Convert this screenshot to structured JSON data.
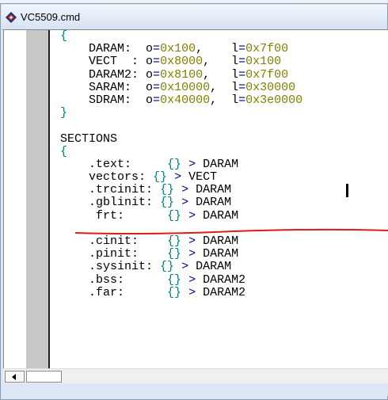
{
  "window": {
    "title": "VC5509.cmd",
    "icon": "diamond-app-icon"
  },
  "editor": {
    "lines": [
      [
        {
          "t": "{",
          "c": "brace"
        }
      ],
      [
        {
          "t": "    DARAM:  ",
          "c": "kw"
        },
        {
          "t": "o",
          "c": "kw"
        },
        {
          "t": "=",
          "c": "op"
        },
        {
          "t": "0x100",
          "c": "num"
        },
        {
          "t": ",    ",
          "c": "kw"
        },
        {
          "t": "l",
          "c": "kw"
        },
        {
          "t": "=",
          "c": "op"
        },
        {
          "t": "0x7f00",
          "c": "num"
        }
      ],
      [
        {
          "t": "    VECT  : ",
          "c": "kw"
        },
        {
          "t": "o",
          "c": "kw"
        },
        {
          "t": "=",
          "c": "op"
        },
        {
          "t": "0x8000",
          "c": "num"
        },
        {
          "t": ",   ",
          "c": "kw"
        },
        {
          "t": "l",
          "c": "kw"
        },
        {
          "t": "=",
          "c": "op"
        },
        {
          "t": "0x100",
          "c": "num"
        }
      ],
      [
        {
          "t": "    DARAM2: ",
          "c": "kw"
        },
        {
          "t": "o",
          "c": "kw"
        },
        {
          "t": "=",
          "c": "op"
        },
        {
          "t": "0x8100",
          "c": "num"
        },
        {
          "t": ",   ",
          "c": "kw"
        },
        {
          "t": "l",
          "c": "kw"
        },
        {
          "t": "=",
          "c": "op"
        },
        {
          "t": "0x7f00",
          "c": "num"
        }
      ],
      [
        {
          "t": "    SARAM:  ",
          "c": "kw"
        },
        {
          "t": "o",
          "c": "kw"
        },
        {
          "t": "=",
          "c": "op"
        },
        {
          "t": "0x10000",
          "c": "num"
        },
        {
          "t": ",  ",
          "c": "kw"
        },
        {
          "t": "l",
          "c": "kw"
        },
        {
          "t": "=",
          "c": "op"
        },
        {
          "t": "0x30000",
          "c": "num"
        }
      ],
      [
        {
          "t": "    SDRAM:  ",
          "c": "kw"
        },
        {
          "t": "o",
          "c": "kw"
        },
        {
          "t": "=",
          "c": "op"
        },
        {
          "t": "0x40000",
          "c": "num"
        },
        {
          "t": ",  ",
          "c": "kw"
        },
        {
          "t": "l",
          "c": "kw"
        },
        {
          "t": "=",
          "c": "op"
        },
        {
          "t": "0x3e0000",
          "c": "num"
        }
      ],
      [
        {
          "t": "}",
          "c": "brace"
        }
      ],
      [],
      [
        {
          "t": "SECTIONS",
          "c": "kw"
        }
      ],
      [
        {
          "t": "{",
          "c": "brace"
        }
      ],
      [
        {
          "t": "    .text:     ",
          "c": "kw"
        },
        {
          "t": "{}",
          "c": "brace"
        },
        {
          "t": " ",
          "c": "kw"
        },
        {
          "t": ">",
          "c": "op"
        },
        {
          "t": " DARAM",
          "c": "kw"
        }
      ],
      [
        {
          "t": "    vectors: ",
          "c": "kw"
        },
        {
          "t": "{}",
          "c": "brace"
        },
        {
          "t": " ",
          "c": "kw"
        },
        {
          "t": ">",
          "c": "op"
        },
        {
          "t": " VECT",
          "c": "kw"
        }
      ],
      [
        {
          "t": "    .trcinit: ",
          "c": "kw"
        },
        {
          "t": "{}",
          "c": "brace"
        },
        {
          "t": " ",
          "c": "kw"
        },
        {
          "t": ">",
          "c": "op"
        },
        {
          "t": " DARAM",
          "c": "kw"
        }
      ],
      [
        {
          "t": "    .gblinit: ",
          "c": "kw"
        },
        {
          "t": "{}",
          "c": "brace"
        },
        {
          "t": " ",
          "c": "kw"
        },
        {
          "t": ">",
          "c": "op"
        },
        {
          "t": " DARAM",
          "c": "kw"
        }
      ],
      [
        {
          "t": "     frt:      ",
          "c": "kw"
        },
        {
          "t": "{}",
          "c": "brace"
        },
        {
          "t": " ",
          "c": "kw"
        },
        {
          "t": ">",
          "c": "op"
        },
        {
          "t": " DARAM",
          "c": "kw"
        }
      ],
      [],
      [
        {
          "t": "    .cinit:    ",
          "c": "kw"
        },
        {
          "t": "{}",
          "c": "brace"
        },
        {
          "t": " ",
          "c": "kw"
        },
        {
          "t": ">",
          "c": "op"
        },
        {
          "t": " DARAM",
          "c": "kw"
        }
      ],
      [
        {
          "t": "    .pinit:    ",
          "c": "kw"
        },
        {
          "t": "{}",
          "c": "brace"
        },
        {
          "t": " ",
          "c": "kw"
        },
        {
          "t": ">",
          "c": "op"
        },
        {
          "t": " DARAM",
          "c": "kw"
        }
      ],
      [
        {
          "t": "    .sysinit: ",
          "c": "kw"
        },
        {
          "t": "{}",
          "c": "brace"
        },
        {
          "t": " ",
          "c": "kw"
        },
        {
          "t": ">",
          "c": "op"
        },
        {
          "t": " DARAM",
          "c": "kw"
        }
      ],
      [
        {
          "t": "    .bss:      ",
          "c": "kw"
        },
        {
          "t": "{}",
          "c": "brace"
        },
        {
          "t": " ",
          "c": "kw"
        },
        {
          "t": ">",
          "c": "op"
        },
        {
          "t": " DARAM2",
          "c": "kw"
        }
      ],
      [
        {
          "t": "    .far:      ",
          "c": "kw"
        },
        {
          "t": "{}",
          "c": "brace"
        },
        {
          "t": " ",
          "c": "kw"
        },
        {
          "t": ">",
          "c": "op"
        },
        {
          "t": " DARAM2",
          "c": "kw"
        }
      ]
    ]
  },
  "annotation": {
    "color": "#e01b1b"
  },
  "colors": {
    "keyword": "#000000",
    "number": "#808000",
    "brace": "#008080",
    "operator": "#000080"
  }
}
